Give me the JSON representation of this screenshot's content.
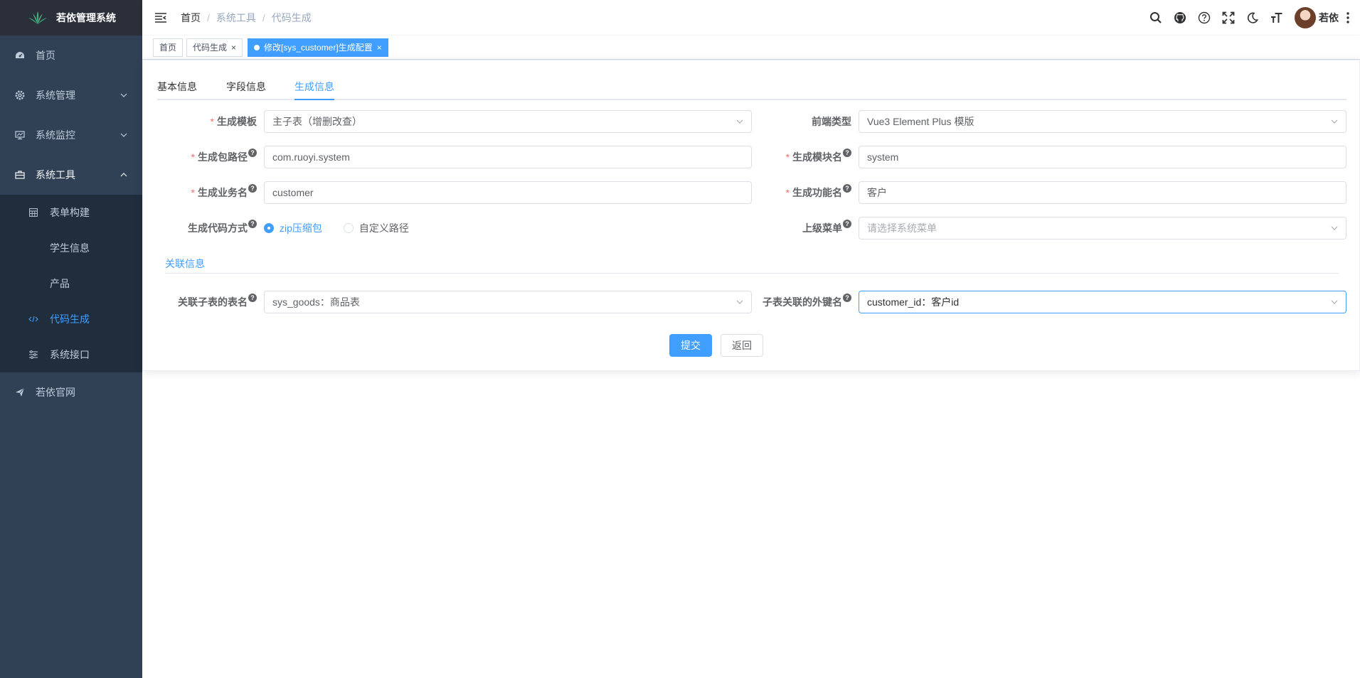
{
  "app": {
    "title": "若依管理系统"
  },
  "sidebar": {
    "items": [
      {
        "label": "首页",
        "icon": "dashboard-icon"
      },
      {
        "label": "系统管理",
        "icon": "gear-icon"
      },
      {
        "label": "系统监控",
        "icon": "monitor-icon"
      },
      {
        "label": "系统工具",
        "icon": "toolbox-icon"
      },
      {
        "label": "若依官网",
        "icon": "paper-plane-icon"
      }
    ],
    "tools_sub": [
      {
        "label": "表单构建",
        "icon": "table-icon"
      },
      {
        "label": "学生信息"
      },
      {
        "label": "产品"
      },
      {
        "label": "代码生成",
        "icon": "code-icon"
      },
      {
        "label": "系统接口",
        "icon": "sliders-icon"
      }
    ]
  },
  "breadcrumb": [
    "首页",
    "系统工具",
    "代码生成"
  ],
  "user": {
    "name": "若依"
  },
  "tags": [
    {
      "label": "首页"
    },
    {
      "label": "代码生成",
      "close": "×"
    },
    {
      "label": "修改[sys_customer]生成配置",
      "close": "×"
    }
  ],
  "tabs": [
    "基本信息",
    "字段信息",
    "生成信息"
  ],
  "form": {
    "required_mark": "*",
    "help_mark": "?",
    "tpl_label": "生成模板",
    "tpl_value": "主子表（增删改查）",
    "frontend_label": "前端类型",
    "frontend_value": "Vue3 Element Plus 模版",
    "package_label": "生成包路径",
    "package_value": "com.ruoyi.system",
    "module_label": "生成模块名",
    "module_value": "system",
    "business_label": "生成业务名",
    "business_value": "customer",
    "function_label": "生成功能名",
    "function_value": "客户",
    "gentype_label": "生成代码方式",
    "gentype_options": [
      "zip压缩包",
      "自定义路径"
    ],
    "parent_menu_label": "上级菜单",
    "parent_menu_placeholder": "请选择系统菜单",
    "section_title": "关联信息",
    "sub_table_label": "关联子表的表名",
    "sub_table_value": "sys_goods：商品表",
    "sub_fk_label": "子表关联的外键名",
    "sub_fk_value": "customer_id：客户id"
  },
  "buttons": {
    "submit": "提交",
    "back": "返回"
  },
  "colors": {
    "primary": "#409eff",
    "sidebar_bg": "#304156",
    "submenu_bg": "#1f2d3d",
    "required": "#f56c6c"
  }
}
